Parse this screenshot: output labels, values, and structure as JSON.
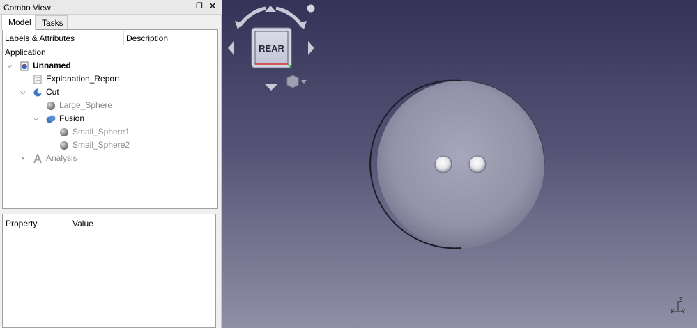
{
  "combo_view": {
    "title": "Combo View",
    "float_icon": "float-window-icon",
    "close_icon": "close-icon",
    "tabs": [
      {
        "label": "Model",
        "active": true
      },
      {
        "label": "Tasks",
        "active": false
      }
    ]
  },
  "tree": {
    "header": {
      "labels_col": "Labels & Attributes",
      "description_col": "Description"
    },
    "application_label": "Application",
    "items": [
      {
        "label": "Unnamed",
        "icon": "document-icon",
        "expanded": true
      },
      {
        "label": "Explanation_Report",
        "icon": "text-document-icon"
      },
      {
        "label": "Cut",
        "icon": "cut-icon",
        "expanded": true
      },
      {
        "label": "Large_Sphere",
        "icon": "sphere-icon"
      },
      {
        "label": "Fusion",
        "icon": "fusion-icon",
        "expanded": true
      },
      {
        "label": "Small_Sphere1",
        "icon": "sphere-icon"
      },
      {
        "label": "Small_Sphere2",
        "icon": "sphere-icon"
      },
      {
        "label": "Analysis",
        "icon": "analysis-icon",
        "expanded": false
      }
    ]
  },
  "property_view": {
    "property_col": "Property",
    "value_col": "Value"
  },
  "navigation_cube": {
    "face_label": "REAR"
  },
  "axis_indicator": {
    "x": "X",
    "y": "Y",
    "z": "Z"
  },
  "colors": {
    "viewport_top": "#343357",
    "viewport_bottom": "#8f8fa6",
    "sphere": "#9c9cb0"
  }
}
